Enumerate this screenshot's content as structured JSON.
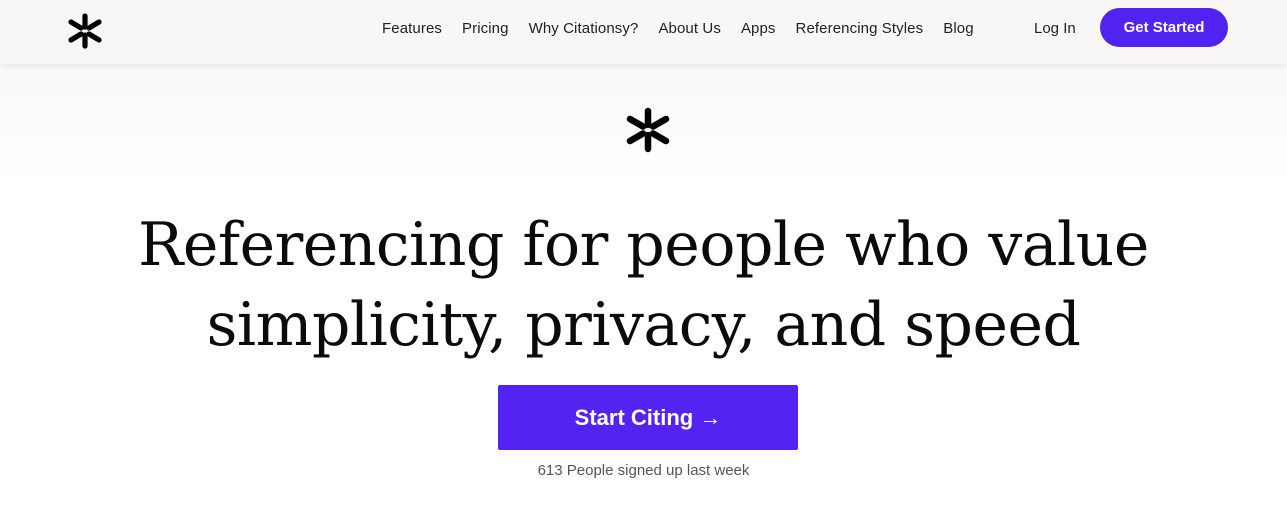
{
  "header": {
    "logo_icon": "asterisk-logo-icon",
    "nav": [
      {
        "label": "Features"
      },
      {
        "label": "Pricing"
      },
      {
        "label": "Why Citationsy?"
      },
      {
        "label": "About Us"
      },
      {
        "label": "Apps"
      },
      {
        "label": "Referencing Styles"
      },
      {
        "label": "Blog"
      }
    ],
    "login_label": "Log In",
    "cta_label": "Get Started"
  },
  "hero": {
    "mark_icon": "asterisk-logo-icon",
    "headline_line1": "Referencing for people who value",
    "headline_line2": "simplicity, privacy, and speed",
    "button_label": "Start Citing →",
    "signup_note": "613 People signed up last week"
  },
  "colors": {
    "accent": "#5023f0",
    "header_bg": "#f8f7f6",
    "text": "#111111"
  }
}
